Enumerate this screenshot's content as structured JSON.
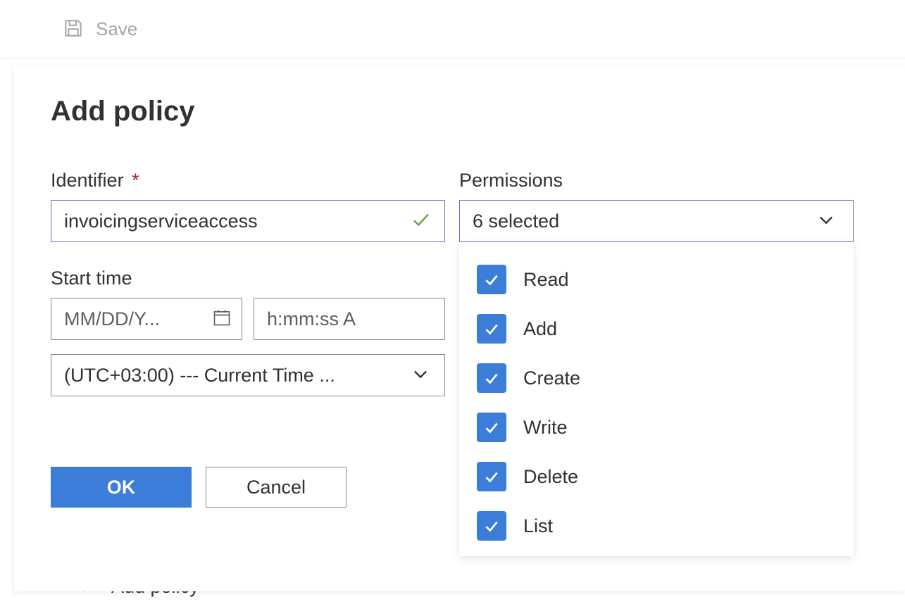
{
  "toolbar": {
    "save_label": "Save"
  },
  "panel": {
    "title": "Add policy"
  },
  "identifier": {
    "label": "Identifier",
    "required": "*",
    "value": "invoicingserviceaccess"
  },
  "starttime": {
    "label": "Start time",
    "date_placeholder": "MM/DD/Y...",
    "time_placeholder": "h:mm:ss A",
    "timezone_display": "(UTC+03:00) --- Current Time ..."
  },
  "permissions": {
    "label": "Permissions",
    "summary": "6 selected",
    "options": [
      {
        "label": "Read",
        "checked": true
      },
      {
        "label": "Add",
        "checked": true
      },
      {
        "label": "Create",
        "checked": true
      },
      {
        "label": "Write",
        "checked": true
      },
      {
        "label": "Delete",
        "checked": true
      },
      {
        "label": "List",
        "checked": true
      }
    ]
  },
  "buttons": {
    "ok": "OK",
    "cancel": "Cancel"
  },
  "background": {
    "add_policy": "Add policy"
  }
}
